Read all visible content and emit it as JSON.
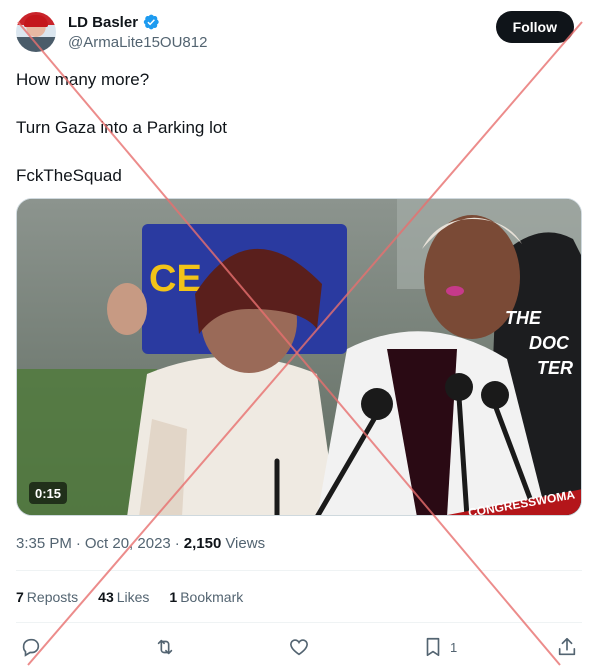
{
  "user": {
    "display_name": "LD Basler",
    "handle": "@ArmaLite15OU812",
    "follow_label": "Follow"
  },
  "tweet": {
    "lines": [
      "How many more?",
      "Turn Gaza into a Parking lot",
      "FckTheSquad"
    ]
  },
  "media": {
    "duration": "0:15",
    "sign_text": "CE",
    "banner_text": "CONGRESSWOMA",
    "shirt_text": "THE\nDOC\nTER"
  },
  "meta": {
    "time": "3:35 PM",
    "separator": "·",
    "date": "Oct 20, 2023",
    "views_count": "2,150",
    "views_label": "Views"
  },
  "stats": {
    "reposts_count": "7",
    "reposts_label": "Reposts",
    "likes_count": "43",
    "likes_label": "Likes",
    "bookmarks_count": "1",
    "bookmarks_label": "Bookmark"
  },
  "actions": {
    "bookmark_count": "1"
  },
  "colors": {
    "accent": "#1d9bf0",
    "watermark": "#e8706f"
  }
}
